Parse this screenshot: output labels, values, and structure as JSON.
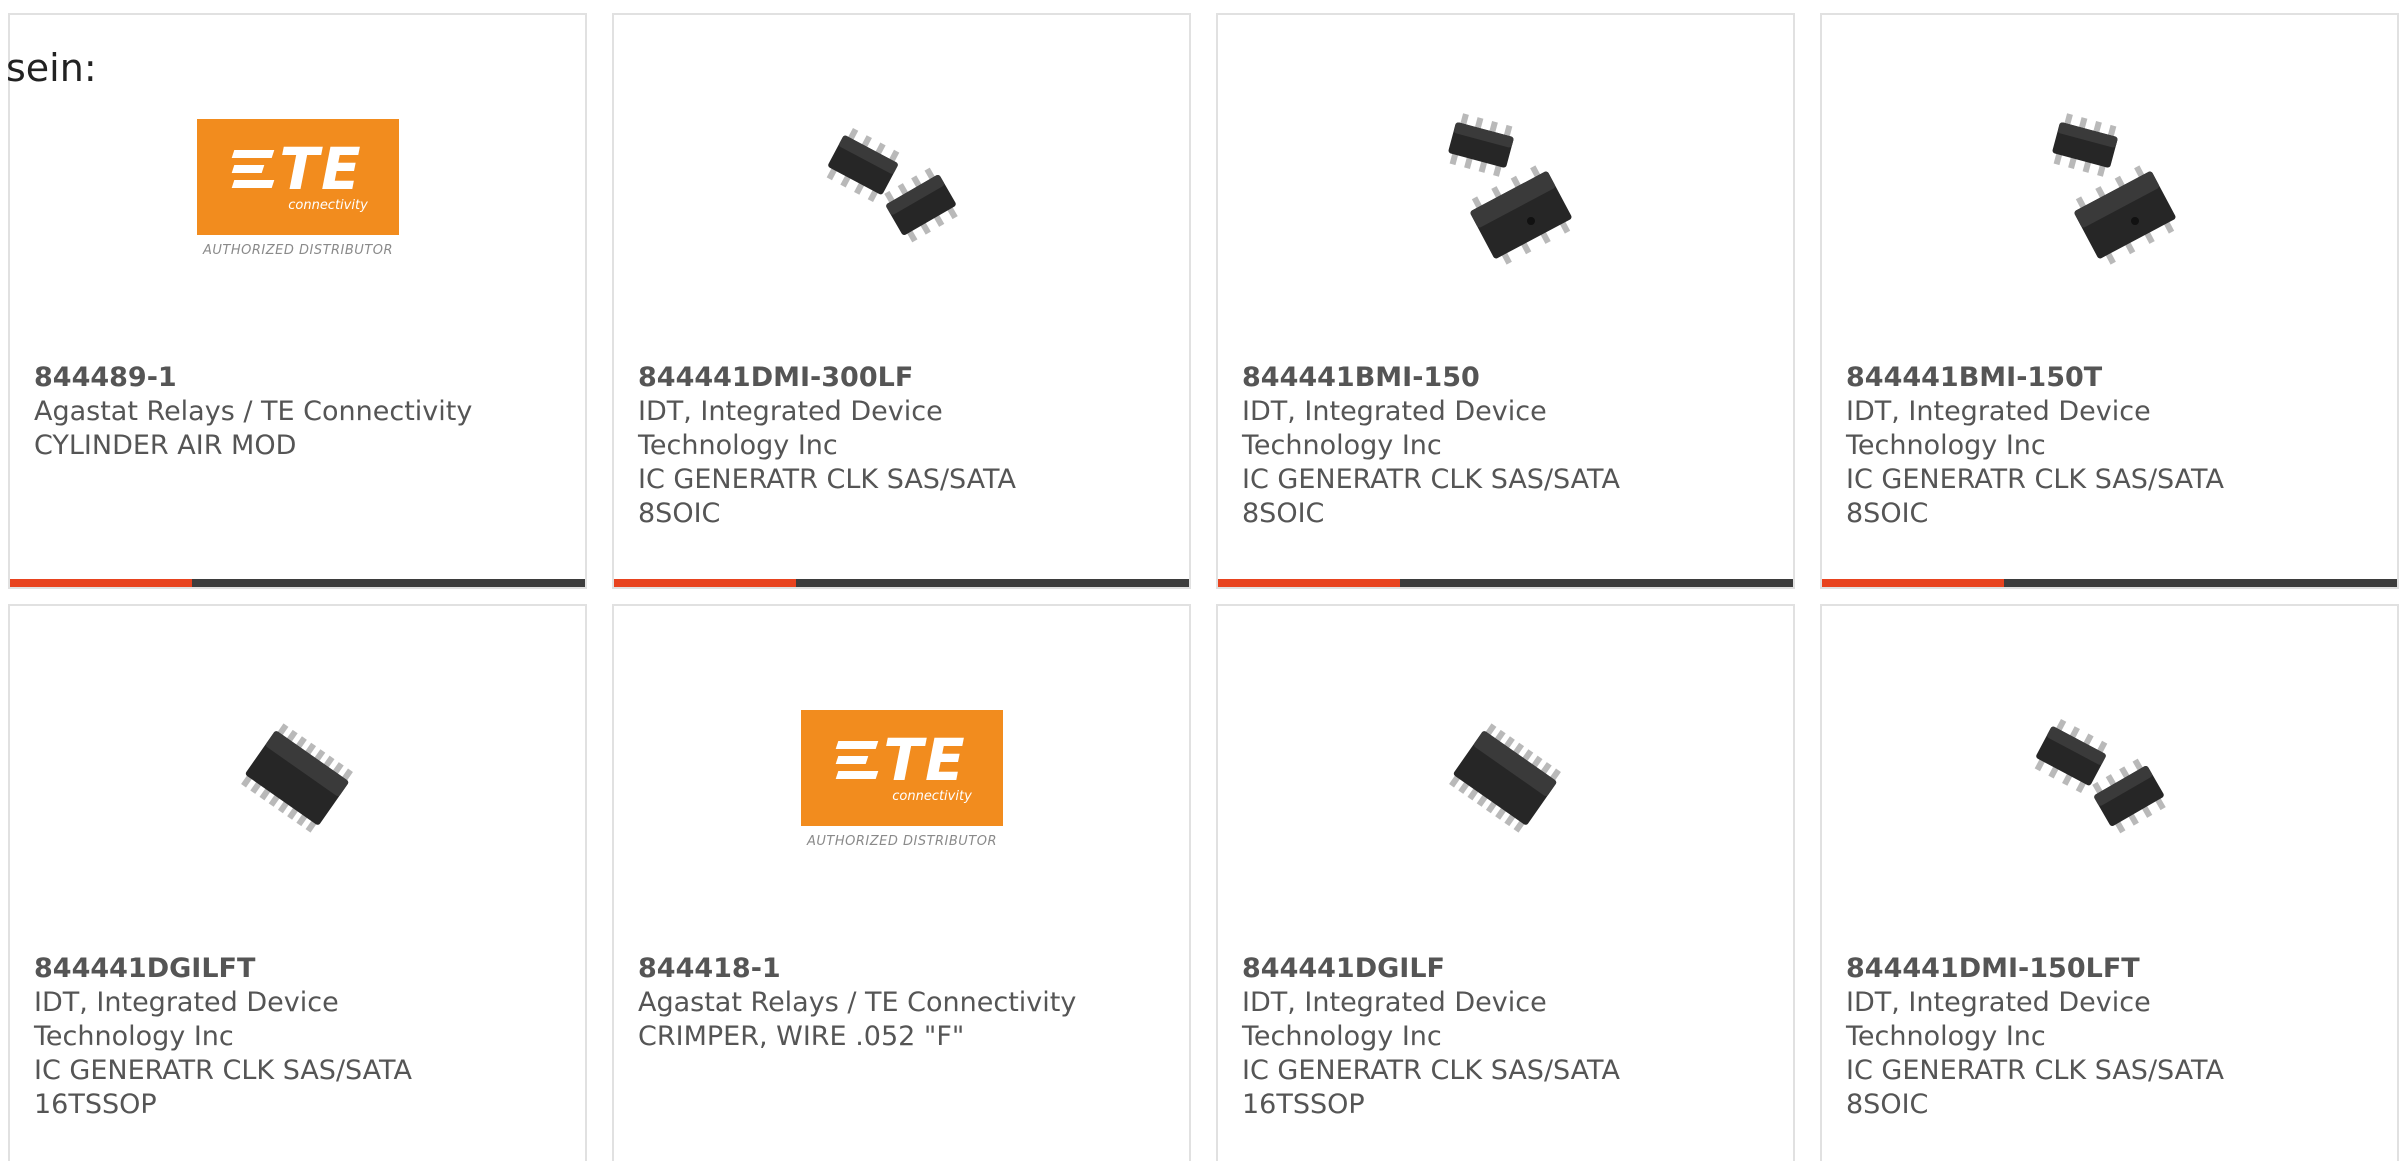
{
  "intro_text": "sein:",
  "accent_color": "#e8431f",
  "bar_color": "#3d3d3d",
  "logo": {
    "brand": "TE",
    "sub": "connectivity",
    "tag": "AUTHORIZED DISTRIBUTOR",
    "color": "#f28c1e"
  },
  "products": [
    {
      "part_number": "844489-1",
      "manufacturer": "Agastat Relays / TE Connectivity",
      "description": "CYLINDER AIR MOD",
      "image": "te-logo"
    },
    {
      "part_number": "844441DMI-300LF",
      "manufacturer": "IDT, Integrated Device Technology Inc",
      "description": "IC GENERATR CLK SAS/SATA 8SOIC",
      "image": "soic8-pair"
    },
    {
      "part_number": "844441BMI-150",
      "manufacturer": "IDT, Integrated Device Technology Inc",
      "description": "IC GENERATR CLK SAS/SATA 8SOIC",
      "image": "soic8-stack"
    },
    {
      "part_number": "844441BMI-150T",
      "manufacturer": "IDT, Integrated Device Technology Inc",
      "description": "IC GENERATR CLK SAS/SATA 8SOIC",
      "image": "soic8-stack"
    },
    {
      "part_number": "844441DGILFT",
      "manufacturer": "IDT, Integrated Device Technology Inc",
      "description": "IC GENERATR CLK SAS/SATA 16TSSOP",
      "image": "tssop16"
    },
    {
      "part_number": "844418-1",
      "manufacturer": "Agastat Relays / TE Connectivity",
      "description": "CRIMPER, WIRE .052 \"F\"",
      "image": "te-logo"
    },
    {
      "part_number": "844441DGILF",
      "manufacturer": "IDT, Integrated Device Technology Inc",
      "description": "IC GENERATR CLK SAS/SATA 16TSSOP",
      "image": "tssop16"
    },
    {
      "part_number": "844441DMI-150LFT",
      "manufacturer": "IDT, Integrated Device Technology Inc",
      "description": "IC GENERATR CLK SAS/SATA 8SOIC",
      "image": "soic8-pair"
    }
  ]
}
